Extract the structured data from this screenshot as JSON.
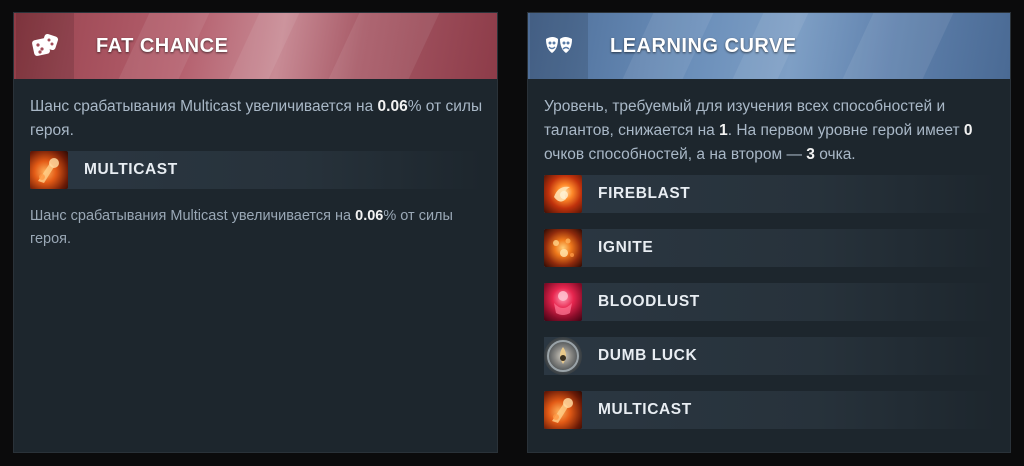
{
  "left_card": {
    "title": "FAT CHANCE",
    "icon": "dice-icon",
    "banner_color": "#a14c58",
    "description": {
      "prefix": "Шанс срабатывания Multicast увеличивается на ",
      "value": "0.06",
      "suffix": "% от силы героя."
    },
    "ability": {
      "name": "MULTICAST",
      "icon": "multicast-icon"
    },
    "sub_description": {
      "prefix": "Шанс срабатывания Multicast увеличивается на ",
      "value": "0.06",
      "suffix": "% от силы героя."
    }
  },
  "right_card": {
    "title": "LEARNING CURVE",
    "icon": "masks-icon",
    "banner_color": "#587aa5",
    "description": {
      "part1": "Уровень, требуемый для изучения всех способностей и талантов, снижается на ",
      "value1": "1",
      "part2": ". На первом уровне герой имеет ",
      "value2": "0",
      "part3": " очков способностей, а на втором — ",
      "value3": "3",
      "part4": " очка."
    },
    "abilities": [
      {
        "name": "FIREBLAST",
        "icon": "fireblast-icon"
      },
      {
        "name": "IGNITE",
        "icon": "ignite-icon"
      },
      {
        "name": "BLOODLUST",
        "icon": "bloodlust-icon"
      },
      {
        "name": "DUMB LUCK",
        "icon": "dumb-luck-icon"
      },
      {
        "name": "MULTICAST",
        "icon": "multicast-icon"
      }
    ]
  }
}
